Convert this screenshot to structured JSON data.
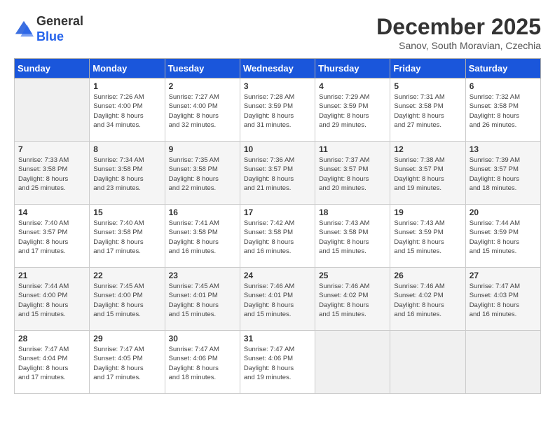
{
  "logo": {
    "general": "General",
    "blue": "Blue"
  },
  "title": "December 2025",
  "subtitle": "Sanov, South Moravian, Czechia",
  "headers": [
    "Sunday",
    "Monday",
    "Tuesday",
    "Wednesday",
    "Thursday",
    "Friday",
    "Saturday"
  ],
  "weeks": [
    [
      {
        "num": "",
        "info": ""
      },
      {
        "num": "1",
        "info": "Sunrise: 7:26 AM\nSunset: 4:00 PM\nDaylight: 8 hours\nand 34 minutes."
      },
      {
        "num": "2",
        "info": "Sunrise: 7:27 AM\nSunset: 4:00 PM\nDaylight: 8 hours\nand 32 minutes."
      },
      {
        "num": "3",
        "info": "Sunrise: 7:28 AM\nSunset: 3:59 PM\nDaylight: 8 hours\nand 31 minutes."
      },
      {
        "num": "4",
        "info": "Sunrise: 7:29 AM\nSunset: 3:59 PM\nDaylight: 8 hours\nand 29 minutes."
      },
      {
        "num": "5",
        "info": "Sunrise: 7:31 AM\nSunset: 3:58 PM\nDaylight: 8 hours\nand 27 minutes."
      },
      {
        "num": "6",
        "info": "Sunrise: 7:32 AM\nSunset: 3:58 PM\nDaylight: 8 hours\nand 26 minutes."
      }
    ],
    [
      {
        "num": "7",
        "info": "Sunrise: 7:33 AM\nSunset: 3:58 PM\nDaylight: 8 hours\nand 25 minutes."
      },
      {
        "num": "8",
        "info": "Sunrise: 7:34 AM\nSunset: 3:58 PM\nDaylight: 8 hours\nand 23 minutes."
      },
      {
        "num": "9",
        "info": "Sunrise: 7:35 AM\nSunset: 3:58 PM\nDaylight: 8 hours\nand 22 minutes."
      },
      {
        "num": "10",
        "info": "Sunrise: 7:36 AM\nSunset: 3:57 PM\nDaylight: 8 hours\nand 21 minutes."
      },
      {
        "num": "11",
        "info": "Sunrise: 7:37 AM\nSunset: 3:57 PM\nDaylight: 8 hours\nand 20 minutes."
      },
      {
        "num": "12",
        "info": "Sunrise: 7:38 AM\nSunset: 3:57 PM\nDaylight: 8 hours\nand 19 minutes."
      },
      {
        "num": "13",
        "info": "Sunrise: 7:39 AM\nSunset: 3:57 PM\nDaylight: 8 hours\nand 18 minutes."
      }
    ],
    [
      {
        "num": "14",
        "info": "Sunrise: 7:40 AM\nSunset: 3:57 PM\nDaylight: 8 hours\nand 17 minutes."
      },
      {
        "num": "15",
        "info": "Sunrise: 7:40 AM\nSunset: 3:58 PM\nDaylight: 8 hours\nand 17 minutes."
      },
      {
        "num": "16",
        "info": "Sunrise: 7:41 AM\nSunset: 3:58 PM\nDaylight: 8 hours\nand 16 minutes."
      },
      {
        "num": "17",
        "info": "Sunrise: 7:42 AM\nSunset: 3:58 PM\nDaylight: 8 hours\nand 16 minutes."
      },
      {
        "num": "18",
        "info": "Sunrise: 7:43 AM\nSunset: 3:58 PM\nDaylight: 8 hours\nand 15 minutes."
      },
      {
        "num": "19",
        "info": "Sunrise: 7:43 AM\nSunset: 3:59 PM\nDaylight: 8 hours\nand 15 minutes."
      },
      {
        "num": "20",
        "info": "Sunrise: 7:44 AM\nSunset: 3:59 PM\nDaylight: 8 hours\nand 15 minutes."
      }
    ],
    [
      {
        "num": "21",
        "info": "Sunrise: 7:44 AM\nSunset: 4:00 PM\nDaylight: 8 hours\nand 15 minutes."
      },
      {
        "num": "22",
        "info": "Sunrise: 7:45 AM\nSunset: 4:00 PM\nDaylight: 8 hours\nand 15 minutes."
      },
      {
        "num": "23",
        "info": "Sunrise: 7:45 AM\nSunset: 4:01 PM\nDaylight: 8 hours\nand 15 minutes."
      },
      {
        "num": "24",
        "info": "Sunrise: 7:46 AM\nSunset: 4:01 PM\nDaylight: 8 hours\nand 15 minutes."
      },
      {
        "num": "25",
        "info": "Sunrise: 7:46 AM\nSunset: 4:02 PM\nDaylight: 8 hours\nand 15 minutes."
      },
      {
        "num": "26",
        "info": "Sunrise: 7:46 AM\nSunset: 4:02 PM\nDaylight: 8 hours\nand 16 minutes."
      },
      {
        "num": "27",
        "info": "Sunrise: 7:47 AM\nSunset: 4:03 PM\nDaylight: 8 hours\nand 16 minutes."
      }
    ],
    [
      {
        "num": "28",
        "info": "Sunrise: 7:47 AM\nSunset: 4:04 PM\nDaylight: 8 hours\nand 17 minutes."
      },
      {
        "num": "29",
        "info": "Sunrise: 7:47 AM\nSunset: 4:05 PM\nDaylight: 8 hours\nand 17 minutes."
      },
      {
        "num": "30",
        "info": "Sunrise: 7:47 AM\nSunset: 4:06 PM\nDaylight: 8 hours\nand 18 minutes."
      },
      {
        "num": "31",
        "info": "Sunrise: 7:47 AM\nSunset: 4:06 PM\nDaylight: 8 hours\nand 19 minutes."
      },
      {
        "num": "",
        "info": ""
      },
      {
        "num": "",
        "info": ""
      },
      {
        "num": "",
        "info": ""
      }
    ]
  ]
}
